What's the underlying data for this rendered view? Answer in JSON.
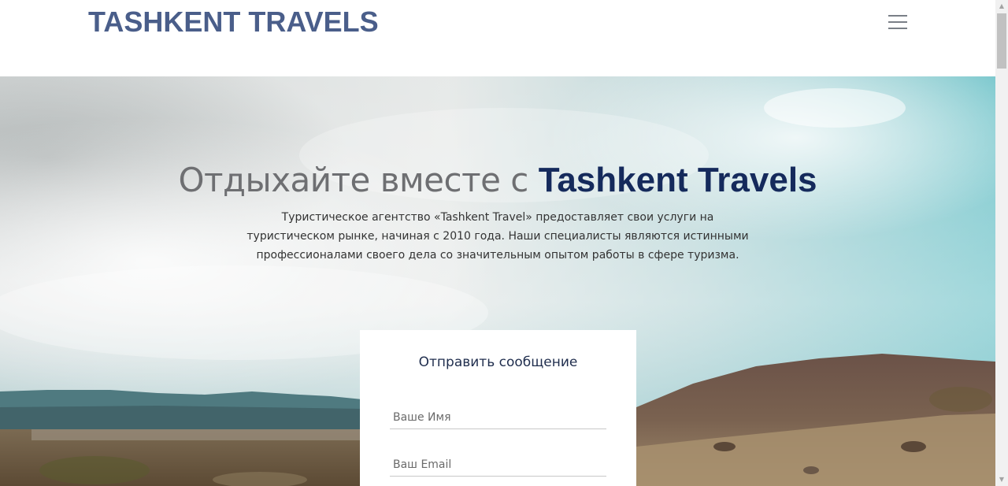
{
  "header": {
    "brand": "TASHKENT TRAVELS",
    "menu_icon": "hamburger-menu-icon"
  },
  "hero": {
    "title_light": "Отдыхайте вместе с ",
    "title_bold": "Tashkent Travels",
    "description": "Туристическое агентство «Tashkent Travel» предоставляет свои услуги на туристическом рынке, начиная с 2010 года. Наши специалисты являются истинными профессионалами своего дела со значительным опытом работы в сфере туризма."
  },
  "form": {
    "title": "Отправить сообщение",
    "name_placeholder": "Ваше Имя",
    "email_placeholder": "Ваш Email"
  },
  "colors": {
    "brand": "#4a5e8a",
    "title_accent": "#152a5c"
  }
}
